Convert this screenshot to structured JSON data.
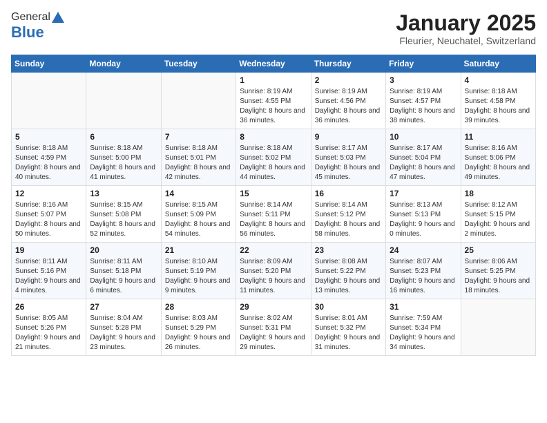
{
  "header": {
    "logo_general": "General",
    "logo_blue": "Blue",
    "month_title": "January 2025",
    "location": "Fleurier, Neuchatel, Switzerland"
  },
  "weekdays": [
    "Sunday",
    "Monday",
    "Tuesday",
    "Wednesday",
    "Thursday",
    "Friday",
    "Saturday"
  ],
  "weeks": [
    [
      {
        "day": "",
        "info": ""
      },
      {
        "day": "",
        "info": ""
      },
      {
        "day": "",
        "info": ""
      },
      {
        "day": "1",
        "info": "Sunrise: 8:19 AM\nSunset: 4:55 PM\nDaylight: 8 hours and 36 minutes."
      },
      {
        "day": "2",
        "info": "Sunrise: 8:19 AM\nSunset: 4:56 PM\nDaylight: 8 hours and 36 minutes."
      },
      {
        "day": "3",
        "info": "Sunrise: 8:19 AM\nSunset: 4:57 PM\nDaylight: 8 hours and 38 minutes."
      },
      {
        "day": "4",
        "info": "Sunrise: 8:18 AM\nSunset: 4:58 PM\nDaylight: 8 hours and 39 minutes."
      }
    ],
    [
      {
        "day": "5",
        "info": "Sunrise: 8:18 AM\nSunset: 4:59 PM\nDaylight: 8 hours and 40 minutes."
      },
      {
        "day": "6",
        "info": "Sunrise: 8:18 AM\nSunset: 5:00 PM\nDaylight: 8 hours and 41 minutes."
      },
      {
        "day": "7",
        "info": "Sunrise: 8:18 AM\nSunset: 5:01 PM\nDaylight: 8 hours and 42 minutes."
      },
      {
        "day": "8",
        "info": "Sunrise: 8:18 AM\nSunset: 5:02 PM\nDaylight: 8 hours and 44 minutes."
      },
      {
        "day": "9",
        "info": "Sunrise: 8:17 AM\nSunset: 5:03 PM\nDaylight: 8 hours and 45 minutes."
      },
      {
        "day": "10",
        "info": "Sunrise: 8:17 AM\nSunset: 5:04 PM\nDaylight: 8 hours and 47 minutes."
      },
      {
        "day": "11",
        "info": "Sunrise: 8:16 AM\nSunset: 5:06 PM\nDaylight: 8 hours and 49 minutes."
      }
    ],
    [
      {
        "day": "12",
        "info": "Sunrise: 8:16 AM\nSunset: 5:07 PM\nDaylight: 8 hours and 50 minutes."
      },
      {
        "day": "13",
        "info": "Sunrise: 8:15 AM\nSunset: 5:08 PM\nDaylight: 8 hours and 52 minutes."
      },
      {
        "day": "14",
        "info": "Sunrise: 8:15 AM\nSunset: 5:09 PM\nDaylight: 8 hours and 54 minutes."
      },
      {
        "day": "15",
        "info": "Sunrise: 8:14 AM\nSunset: 5:11 PM\nDaylight: 8 hours and 56 minutes."
      },
      {
        "day": "16",
        "info": "Sunrise: 8:14 AM\nSunset: 5:12 PM\nDaylight: 8 hours and 58 minutes."
      },
      {
        "day": "17",
        "info": "Sunrise: 8:13 AM\nSunset: 5:13 PM\nDaylight: 9 hours and 0 minutes."
      },
      {
        "day": "18",
        "info": "Sunrise: 8:12 AM\nSunset: 5:15 PM\nDaylight: 9 hours and 2 minutes."
      }
    ],
    [
      {
        "day": "19",
        "info": "Sunrise: 8:11 AM\nSunset: 5:16 PM\nDaylight: 9 hours and 4 minutes."
      },
      {
        "day": "20",
        "info": "Sunrise: 8:11 AM\nSunset: 5:18 PM\nDaylight: 9 hours and 6 minutes."
      },
      {
        "day": "21",
        "info": "Sunrise: 8:10 AM\nSunset: 5:19 PM\nDaylight: 9 hours and 9 minutes."
      },
      {
        "day": "22",
        "info": "Sunrise: 8:09 AM\nSunset: 5:20 PM\nDaylight: 9 hours and 11 minutes."
      },
      {
        "day": "23",
        "info": "Sunrise: 8:08 AM\nSunset: 5:22 PM\nDaylight: 9 hours and 13 minutes."
      },
      {
        "day": "24",
        "info": "Sunrise: 8:07 AM\nSunset: 5:23 PM\nDaylight: 9 hours and 16 minutes."
      },
      {
        "day": "25",
        "info": "Sunrise: 8:06 AM\nSunset: 5:25 PM\nDaylight: 9 hours and 18 minutes."
      }
    ],
    [
      {
        "day": "26",
        "info": "Sunrise: 8:05 AM\nSunset: 5:26 PM\nDaylight: 9 hours and 21 minutes."
      },
      {
        "day": "27",
        "info": "Sunrise: 8:04 AM\nSunset: 5:28 PM\nDaylight: 9 hours and 23 minutes."
      },
      {
        "day": "28",
        "info": "Sunrise: 8:03 AM\nSunset: 5:29 PM\nDaylight: 9 hours and 26 minutes."
      },
      {
        "day": "29",
        "info": "Sunrise: 8:02 AM\nSunset: 5:31 PM\nDaylight: 9 hours and 29 minutes."
      },
      {
        "day": "30",
        "info": "Sunrise: 8:01 AM\nSunset: 5:32 PM\nDaylight: 9 hours and 31 minutes."
      },
      {
        "day": "31",
        "info": "Sunrise: 7:59 AM\nSunset: 5:34 PM\nDaylight: 9 hours and 34 minutes."
      },
      {
        "day": "",
        "info": ""
      }
    ]
  ]
}
